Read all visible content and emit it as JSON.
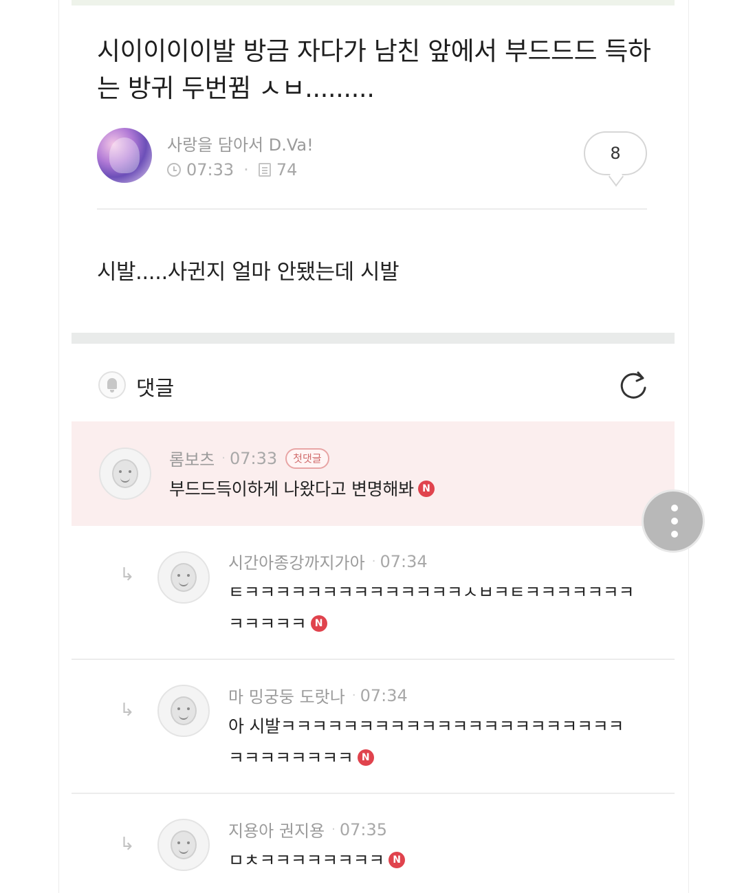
{
  "post": {
    "title": "시이이이이발 방금 자다가 남친 앞에서 부드드드 득하는 방귀 두번뀜 ㅅㅂ.........",
    "author": "사랑을 담아서 D.Va!",
    "time": "07:33",
    "views": "74",
    "comment_count": "8",
    "body": "시발.....사귄지 얼마 안됐는데 시발"
  },
  "comments_section": {
    "heading": "댓글"
  },
  "comments": [
    {
      "author": "롬보츠",
      "time": "07:33",
      "badge": "첫댓글",
      "text": "부드드득이하게 나왔다고 변명해봐",
      "new_badge": "N"
    },
    {
      "author": "시간아종강까지가아",
      "time": "07:34",
      "text_line1": "ㅌㅋㅋㅋㅋㅋㅋㅋㅋㅋㅋㅋㅋㅋㅋㅅㅂㅋㅌㅋㅋㅋㅋㅋㅋㅋ",
      "text_line2": "ㅋㅋㅋㅋㅋ",
      "new_badge": "N"
    },
    {
      "author": "마 밍궁둥 도랏나",
      "time": "07:34",
      "text_line1": "아 시발ㅋㅋㅋㅋㅋㅋㅋㅋㅋㅋㅋㅋㅋㅋㅋㅋㅋㅋㅋㅋㅋㅋ",
      "text_line2": "ㅋㅋㅋㅋㅋㅋㅋㅋ",
      "new_badge": "N"
    },
    {
      "author": "지용아 권지용",
      "time": "07:35",
      "text": "ㅁㅊㅋㅋㅋㅋㅋㅋㅋㅋ",
      "new_badge": "N"
    }
  ],
  "icons": {
    "clock": "clock-icon",
    "views": "document-icon",
    "bell": "bell-icon",
    "refresh": "refresh-icon",
    "reply": "reply-arrow-icon",
    "more": "more-vertical-icon",
    "new": "new-badge-icon"
  },
  "colors": {
    "first_comment_bg": "#fbeeee",
    "new_badge": "#e0434d",
    "badge_border": "#e8a5a5"
  }
}
